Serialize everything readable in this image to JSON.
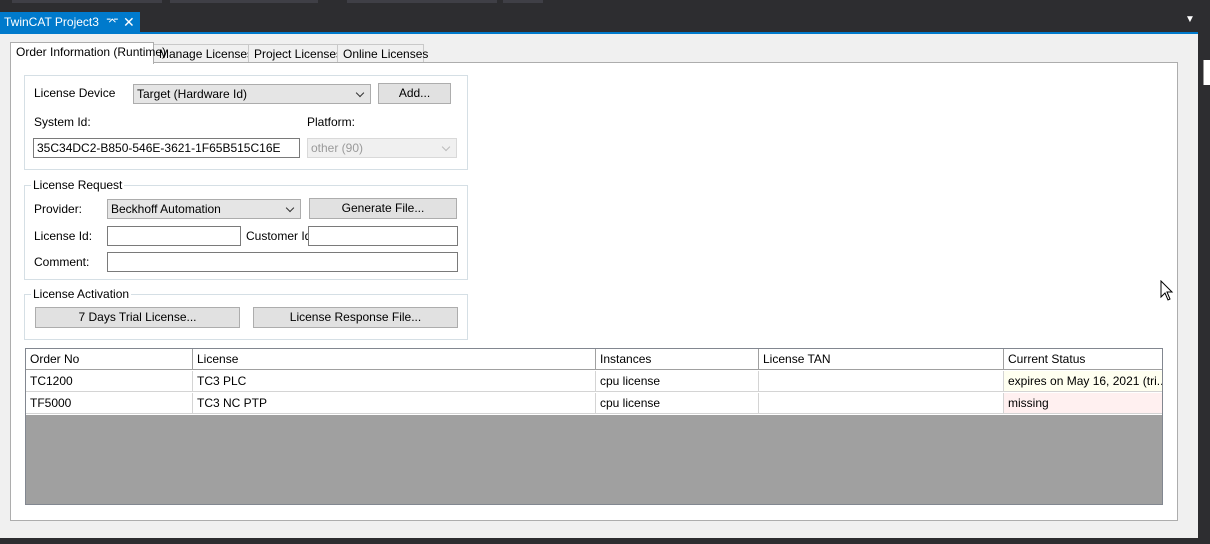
{
  "document_tab": {
    "title": "TwinCAT Project3",
    "pin_glyph": "⌤",
    "close_glyph": "✕"
  },
  "tabs": [
    {
      "label": "Order Information (Runtime)",
      "active": true
    },
    {
      "label": "Manage Licenses",
      "active": false
    },
    {
      "label": "Project Licenses",
      "active": false
    },
    {
      "label": "Online Licenses",
      "active": false
    }
  ],
  "device": {
    "license_device_label": "License Device",
    "license_device_value": "Target (Hardware Id)",
    "add_button": "Add...",
    "system_id_label": "System Id:",
    "system_id_value": "35C34DC2-B850-546E-3621-1F65B515C16E",
    "platform_label": "Platform:",
    "platform_value": "other (90)"
  },
  "license_request": {
    "title": "License Request",
    "provider_label": "Provider:",
    "provider_value": "Beckhoff Automation",
    "generate_button": "Generate File...",
    "license_id_label": "License Id:",
    "license_id_value": "",
    "customer_id_label": "Customer Id:",
    "customer_id_value": "",
    "comment_label": "Comment:",
    "comment_value": ""
  },
  "license_activation": {
    "title": "License Activation",
    "trial_button": "7 Days Trial License...",
    "response_button": "License Response File..."
  },
  "grid": {
    "columns": [
      "Order No",
      "License",
      "Instances",
      "License TAN",
      "Current Status"
    ],
    "rows": [
      {
        "order_no": "TC1200",
        "license": "TC3 PLC",
        "instances": "cpu license",
        "tan": "",
        "status": "expires on May 16, 2021 (tri...",
        "status_color": "#fffff0"
      },
      {
        "order_no": "TF5000",
        "license": "TC3 NC PTP",
        "instances": "cpu license",
        "tan": "",
        "status": "missing",
        "status_color": "#fff0f0"
      }
    ]
  },
  "colors": {
    "accent": "#007acc",
    "chrome": "#2d2d30",
    "grid_empty": "#a0a0a0"
  }
}
